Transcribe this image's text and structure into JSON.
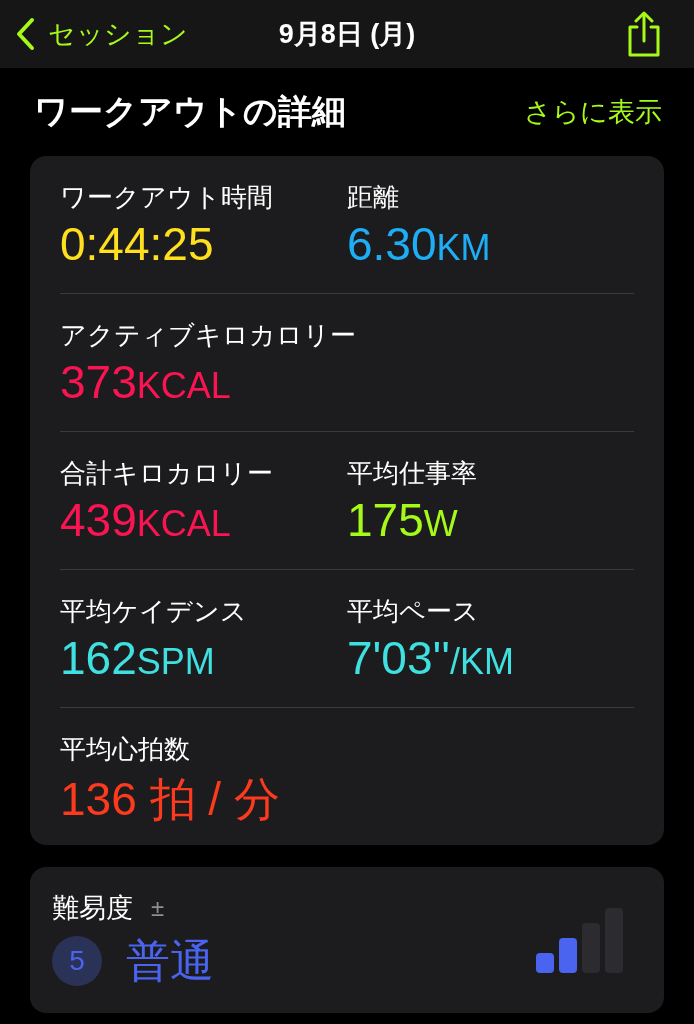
{
  "nav": {
    "back": "セッション",
    "title": "9月8日 (月)"
  },
  "section": {
    "title": "ワークアウトの詳細",
    "more": "さらに表示"
  },
  "metrics": [
    [
      {
        "label": "ワークアウト時間",
        "value": "0:44:25",
        "color": "#ffe01f"
      },
      {
        "label": "距離",
        "value": "6.30",
        "unit": "KM",
        "color": "#1eaef5"
      }
    ],
    [
      {
        "label": "アクティブキロカロリー",
        "value": "373",
        "unit": "KCAL",
        "color": "#fa1452"
      }
    ],
    [
      {
        "label": "合計キロカロリー",
        "value": "439",
        "unit": "KCAL",
        "color": "#fa1452"
      },
      {
        "label": "平均仕事率",
        "value": "175",
        "unit": "W",
        "color": "#a6fa18"
      }
    ],
    [
      {
        "label": "平均ケイデンス",
        "value": "162",
        "unit": "SPM",
        "color": "#40e0e0"
      },
      {
        "label": "平均ペース",
        "value": "7'03''",
        "unit": "/KM",
        "color": "#40e0e0"
      }
    ],
    [
      {
        "label": "平均心拍数",
        "value": "136 拍 / 分",
        "color": "#fb3a1e"
      }
    ]
  ],
  "effort": {
    "label": "難易度",
    "adjust": "±",
    "score": "5",
    "rating": "普通",
    "level": 0.5
  }
}
